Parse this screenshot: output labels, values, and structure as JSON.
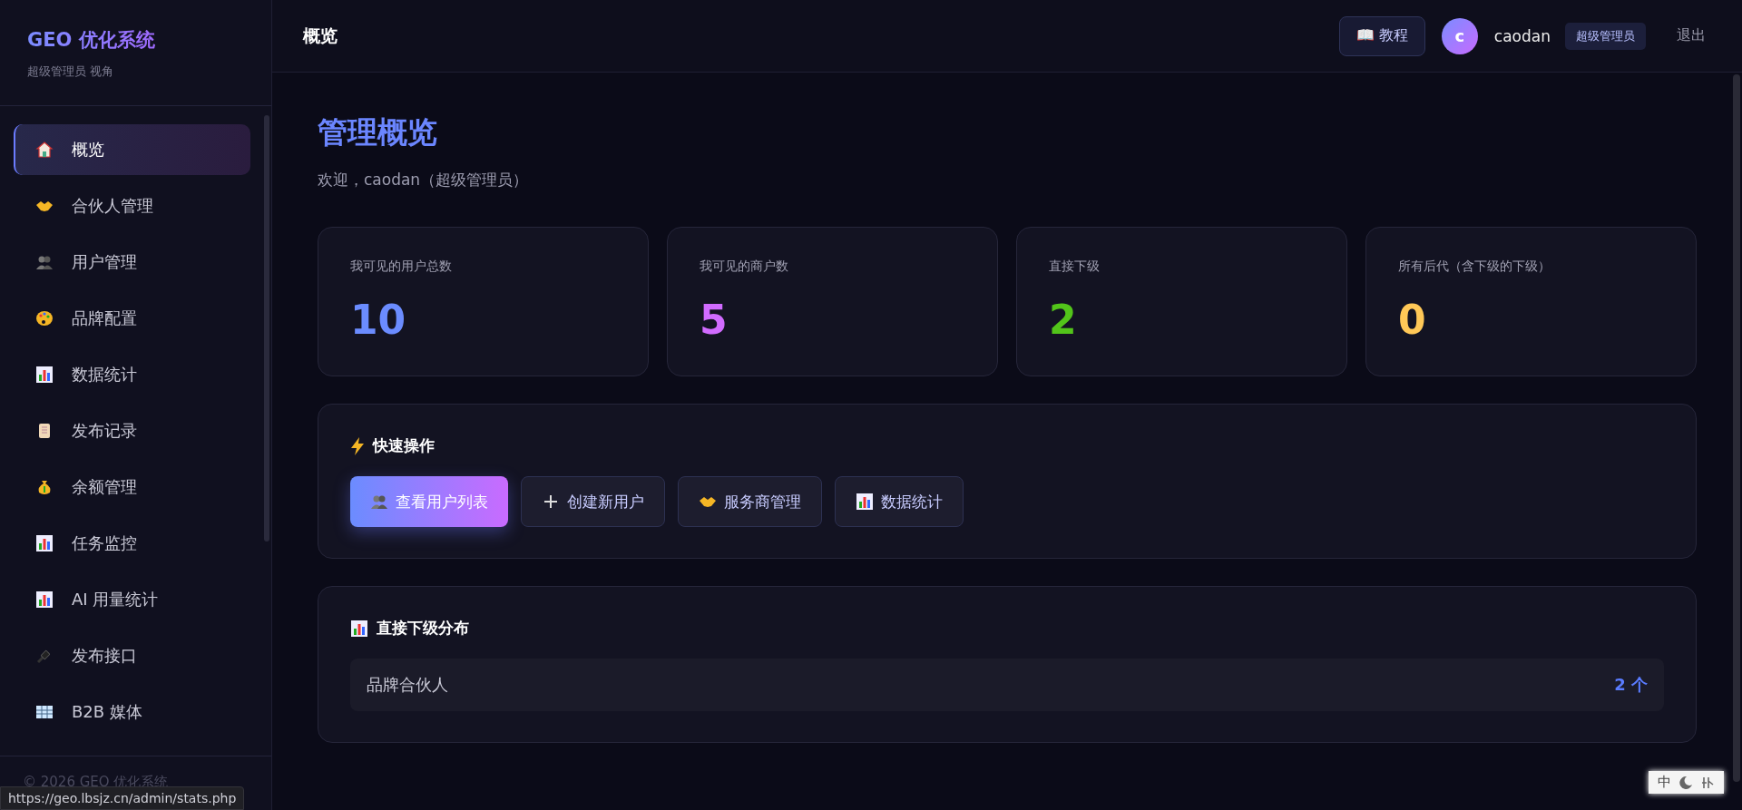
{
  "sidebar": {
    "brand": "GEO 优化系统",
    "subtitle": "超级管理员 视角",
    "items": [
      {
        "label": "概览",
        "selected": true
      },
      {
        "label": "合伙人管理",
        "selected": false
      },
      {
        "label": "用户管理",
        "selected": false
      },
      {
        "label": "品牌配置",
        "selected": false
      },
      {
        "label": "数据统计",
        "selected": false
      },
      {
        "label": "发布记录",
        "selected": false
      },
      {
        "label": "余额管理",
        "selected": false
      },
      {
        "label": "任务监控",
        "selected": false
      },
      {
        "label": "AI 用量统计",
        "selected": false
      },
      {
        "label": "发布接口",
        "selected": false
      },
      {
        "label": "B2B 媒体",
        "selected": false
      }
    ],
    "footer": "© 2026 GEO 优化系统"
  },
  "header": {
    "title": "概览",
    "tutorial_button": "📖 教程",
    "avatar": "c",
    "username": "caodan",
    "role_badge": "超级管理员",
    "logout": "退出"
  },
  "page": {
    "title": "管理概览",
    "welcome": "欢迎，caodan（超级管理员）"
  },
  "stats": [
    {
      "label": "我可见的用户总数",
      "value": "10",
      "color": "#6b8cff"
    },
    {
      "label": "我可见的商户数",
      "value": "5",
      "color": "#d16bff"
    },
    {
      "label": "直接下级",
      "value": "2",
      "color": "#52c41a"
    },
    {
      "label": "所有后代（含下级的下级）",
      "value": "0",
      "color": "#ffc857"
    }
  ],
  "quick_actions": {
    "title": "快速操作",
    "buttons": [
      {
        "label": "查看用户列表",
        "kind": "primary"
      },
      {
        "label": "创建新用户",
        "kind": "secondary"
      },
      {
        "label": "服务商管理",
        "kind": "secondary"
      },
      {
        "label": "数据统计",
        "kind": "secondary"
      }
    ]
  },
  "distribution": {
    "title": "直接下级分布",
    "rows": [
      {
        "name": "品牌合伙人",
        "count": "2 个"
      }
    ]
  },
  "status_url": "https://geo.lbsjz.cn/admin/stats.php",
  "ime_bar": {
    "mode": "中"
  }
}
